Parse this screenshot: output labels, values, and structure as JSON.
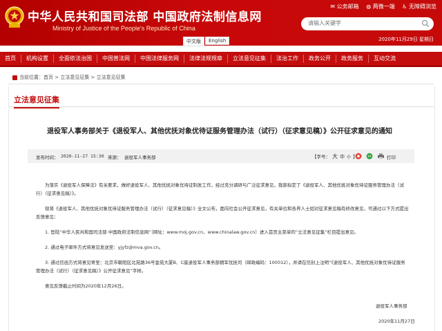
{
  "header": {
    "title": "中华人民共和国司法部  中国政府法制信息网",
    "subtitle": "Ministry of Justice of the People's Republic of China",
    "lang_cn": "中文版",
    "lang_en": "English",
    "top_links": [
      "公务邮箱",
      "两微一端",
      "无障碍浏览"
    ],
    "search_placeholder": "请输入关键字",
    "date": "2020年11月29日 星期日",
    "colors": {
      "brand": "#c40d0d",
      "subtitle": "#fde9c8"
    }
  },
  "nav": {
    "items": [
      "首页",
      "机构设置",
      "全面依法治国",
      "中国普法网",
      "中国法律服务网",
      "法律法规规章",
      "立法意见征集",
      "法治工作",
      "政务公开",
      "政务服务",
      "互动交流"
    ]
  },
  "breadcrumb": {
    "label": "当前位置：",
    "items": [
      "首页",
      "立法意见征集",
      "立法意见征集"
    ]
  },
  "section": {
    "title": "立法意见征集"
  },
  "article": {
    "title": "退役军人事务部关于《退役军人、其他优抚对象优待证服务管理办法（试行）（征求意见稿）》公开征求意见的通知",
    "date_label": "发布时间：",
    "date": "2020-11-27 15:30",
    "source_label": "来源：",
    "source": "退役军人事务部",
    "font_label": "【字号：",
    "font_sizes": [
      "大",
      "中",
      "小",
      "】"
    ],
    "print_label": "打印",
    "paragraphs": [
      "为落实《退役军人保障法》有关要求，做好退役军人、其他优抚对象优待证制发工作，经过充分调研与广泛征求意见，我部拟定了《退役军人、其他优抚对象优待证服务管理办法（试行）（征求意见稿）》。",
      "现将《退役军人、其他优抚对象优待证服务管理办法（试行）（征求意见稿）》全文公布，面向社会公开征求意见，有关单位和各界人士如对征求意见稿有修改意见，可通过以下方式提出反馈意见：",
      "1. 登陆“中华人民共和国司法部 中国政府法制信息网”（网址：www.moj.gov.cn、www.chinalaw.gov.cn）进入首页主菜单的“立法意见征集”栏目提出意见。",
      "2. 通过电子邮件方式将意见发送至：yjyfz@mva.gov.cn。",
      "3. 通过信函方式将意见寄至：北京市朝阳区北苑路36号金苑大厦B、C座退役军人事务部拥军优抚司（邮政编码：100012），并请在信封上注明“《退役军人、其他优抚对象优待证服务管理办法（试行）（征求意见稿）》公开征求意见”字样。",
      "意见反馈截止时间为2020年12月26日。"
    ],
    "signer": "退役军人事务部",
    "sign_date": "2020年11月27日"
  }
}
